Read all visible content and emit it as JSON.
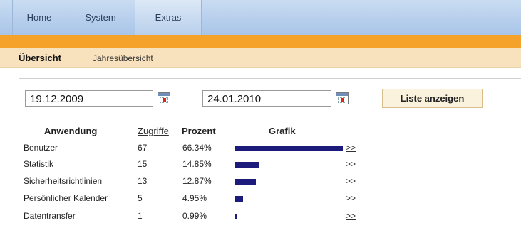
{
  "nav": {
    "tabs": [
      {
        "label": "Home"
      },
      {
        "label": "System"
      },
      {
        "label": "Extras"
      }
    ]
  },
  "subnav": {
    "items": [
      {
        "label": "Übersicht"
      },
      {
        "label": "Jahresübersicht"
      }
    ]
  },
  "filter": {
    "from_date": "19.12.2009",
    "to_date": "24.01.2010",
    "submit_label": "Liste anzeigen"
  },
  "table": {
    "headers": {
      "app": "Anwendung",
      "count": "Zugriffe",
      "percent": "Prozent",
      "chart": "Grafik"
    },
    "rows": [
      {
        "app": "Benutzer",
        "count": "67",
        "percent": "66.34%",
        "share": 0.6634,
        "more": ">>"
      },
      {
        "app": "Statistik",
        "count": "15",
        "percent": "14.85%",
        "share": 0.1485,
        "more": ">>"
      },
      {
        "app": "Sicherheitsrichtlinien",
        "count": "13",
        "percent": "12.87%",
        "share": 0.1287,
        "more": ">>"
      },
      {
        "app": "Persönlicher Kalender",
        "count": "5",
        "percent": "4.95%",
        "share": 0.0495,
        "more": ">>"
      },
      {
        "app": "Datentransfer",
        "count": "1",
        "percent": "0.99%",
        "share": 0.0099,
        "more": ">>"
      }
    ]
  },
  "colors": {
    "accent_bar": "#f4a22a",
    "chart_bar": "#1c1a7a",
    "nav_bg": "#b9d0ec"
  }
}
